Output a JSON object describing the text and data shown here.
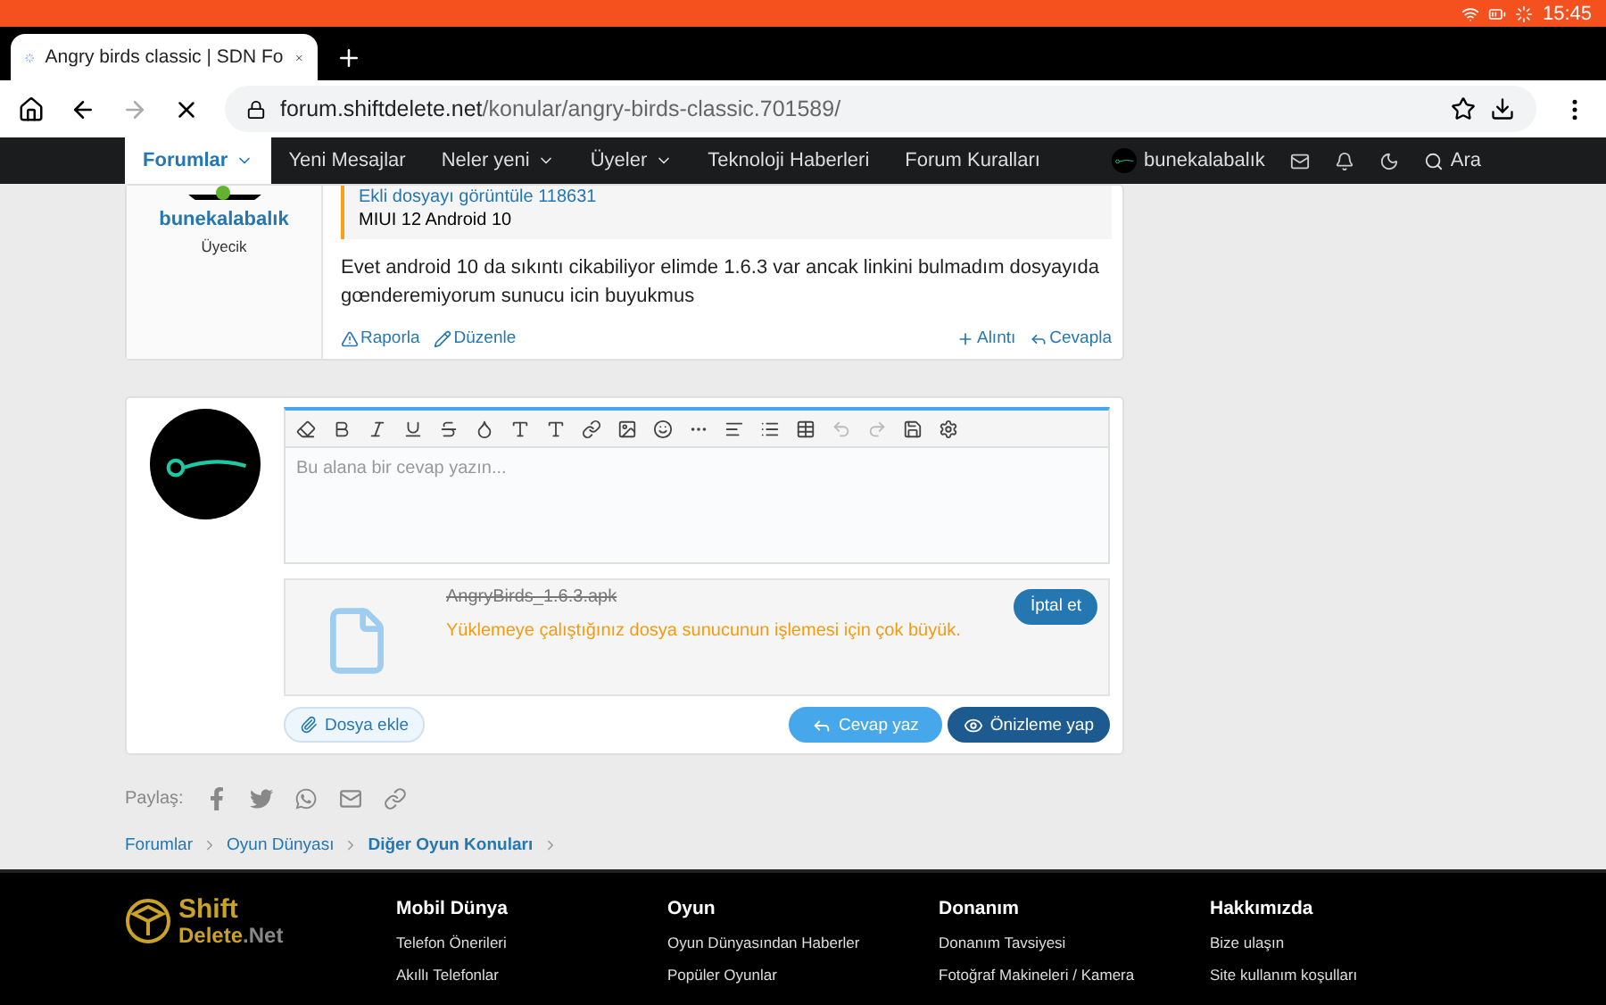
{
  "status_bar": {
    "time": "15:45"
  },
  "browser": {
    "tab_title": "Angry birds classic | SDN Fo",
    "url_host": "forum.shiftdelete.net",
    "url_path": "/konular/angry-birds-classic.701589/"
  },
  "nav": {
    "items": [
      {
        "label": "Forumlar",
        "selected": true,
        "dropdown": true
      },
      {
        "label": "Yeni Mesajlar",
        "selected": false,
        "dropdown": false
      },
      {
        "label": "Neler yeni",
        "selected": false,
        "dropdown": true
      },
      {
        "label": "Üyeler",
        "selected": false,
        "dropdown": true
      },
      {
        "label": "Teknoloji Haberleri",
        "selected": false,
        "dropdown": false
      },
      {
        "label": "Forum Kuralları",
        "selected": false,
        "dropdown": false
      }
    ],
    "user": "bunekalabalık",
    "search": "Ara"
  },
  "post": {
    "author": "bunekalabalık",
    "role": "Üyecik",
    "online": true,
    "quote_link": "Ekli dosyayı görüntüle 118631",
    "quote_text": "MIUI 12 Android 10",
    "message": "Evet android 10 da sıkıntı cikabiliyor elimde 1.6.3 var ancak linkini bulmadım dosyayıda gœnderemiyorum sunucu icin buyukmus",
    "actions_left": [
      {
        "label": "Raporla",
        "kind": "report"
      },
      {
        "label": "Düzenle",
        "kind": "edit"
      }
    ],
    "actions_right": [
      {
        "label": "Alıntı",
        "kind": "quote"
      },
      {
        "label": "Cevapla",
        "kind": "reply"
      }
    ]
  },
  "reply_form": {
    "placeholder": "Bu alana bir cevap yazın...",
    "attachment": {
      "filename": "AngryBirds_1.6.3.apk",
      "failed": true,
      "error": "Yüklemeye çalıştığınız dosya sunucunun işlemesi için çok büyük.",
      "cancel": "İptal et"
    },
    "attach_button": "Dosya ekle",
    "reply_button": "Cevap yaz",
    "preview_button": "Önizleme yap"
  },
  "share": {
    "label": "Paylaş:"
  },
  "breadcrumb": [
    {
      "label": "Forumlar",
      "current": false
    },
    {
      "label": "Oyun Dünyası",
      "current": false
    },
    {
      "label": "Diğer Oyun Konuları",
      "current": true
    }
  ],
  "footer": {
    "logo": {
      "line1": "Shift",
      "line2": "Delete",
      "suffix": ".Net"
    },
    "columns": [
      {
        "heading": "Mobil Dünya",
        "links": [
          "Telefon Önerileri",
          "Akıllı Telefonlar"
        ]
      },
      {
        "heading": "Oyun",
        "links": [
          "Oyun Dünyasından Haberler",
          "Popüler Oyunlar"
        ]
      },
      {
        "heading": "Donanım",
        "links": [
          "Donanım Tavsiyesi",
          "Fotoğraf Makineleri / Kamera"
        ]
      },
      {
        "heading": "Hakkımızda",
        "links": [
          "Bize ulaşın",
          "Site kullanım koşulları"
        ]
      }
    ]
  }
}
